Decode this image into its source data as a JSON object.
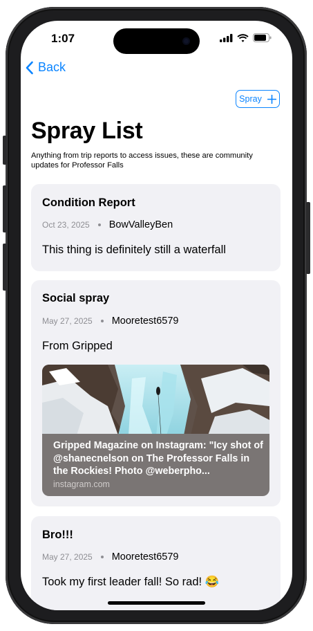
{
  "status_bar": {
    "time": "1:07"
  },
  "nav": {
    "back_label": "Back",
    "spray_button_label": "Spray"
  },
  "page": {
    "title": "Spray List",
    "subtitle": "Anything from trip reports to access issues, these are community updates for Professor Falls"
  },
  "posts": [
    {
      "title": "Condition Report",
      "date": "Oct 23, 2025",
      "author": "BowValleyBen",
      "body": "This thing is definitely still a waterfall"
    },
    {
      "title": "Social spray",
      "date": "May 27, 2025",
      "author": "Mooretest6579",
      "body": "From Gripped",
      "link": {
        "title": "Gripped Magazine on Instagram: \"Icy shot of @shanecnelson on The Professor Falls in the Rockies! Photo @weberpho...",
        "domain": "instagram.com"
      }
    },
    {
      "title": "Bro!!!",
      "date": "May 27, 2025",
      "author": "Mooretest6579",
      "body": "Took my first leader fall! So rad! 😂"
    }
  ],
  "colors": {
    "accent": "#0a84ff",
    "card_bg": "#f1f1f5",
    "meta_gray": "#8e8e93"
  }
}
